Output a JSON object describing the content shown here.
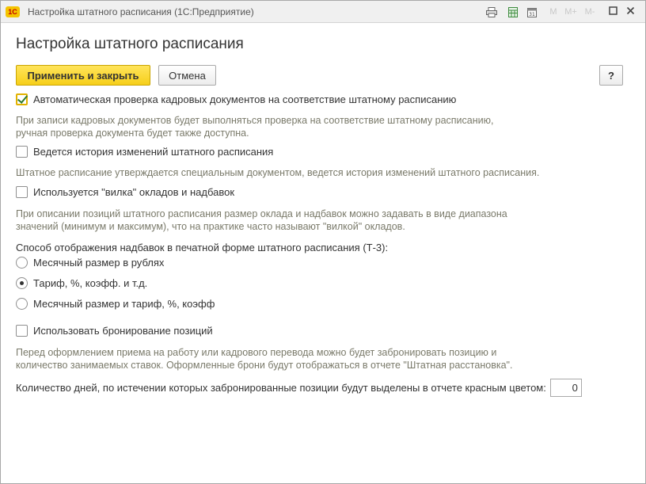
{
  "window": {
    "title": "Настройка штатного расписания  (1С:Предприятие)",
    "logo_text": "1С"
  },
  "header": {
    "title": "Настройка штатного расписания"
  },
  "toolbar": {
    "apply_close_label": "Применить и закрыть",
    "cancel_label": "Отмена",
    "help_label": "?"
  },
  "options": {
    "auto_check": {
      "label": "Автоматическая проверка кадровых документов на соответствие штатному расписанию",
      "checked": true,
      "hint_line1": "При записи кадровых документов будет выполняться проверка на соответствие штатному расписанию,",
      "hint_line2": "ручная проверка документа будет также доступна."
    },
    "history": {
      "label": "Ведется история изменений штатного расписания",
      "checked": false,
      "hint_line1": "Штатное расписание утверждается специальным документом, ведется история изменений штатного расписания."
    },
    "fork": {
      "label": "Используется \"вилка\" окладов и надбавок",
      "checked": false,
      "hint_line1": "При описании позиций штатного расписания размер оклада и надбавок можно задавать в виде диапазона",
      "hint_line2": "значений (минимум и максимум), что на практике часто называют \"вилкой\" окладов."
    },
    "display_mode": {
      "label": "Способ отображения надбавок в печатной форме штатного расписания (Т-3):",
      "choices": [
        {
          "label": "Месячный размер в рублях",
          "selected": false
        },
        {
          "label": "Тариф, %, коэфф. и т.д.",
          "selected": true
        },
        {
          "label": "Месячный размер и тариф, %, коэфф",
          "selected": false
        }
      ]
    },
    "booking": {
      "label": "Использовать бронирование позиций",
      "checked": false,
      "hint_line1": "Перед оформлением приема на работу или кадрового перевода можно будет забронировать позицию и",
      "hint_line2": "количество занимаемых ставок. Оформленные брони будут отображаться в отчете \"Штатная расстановка\"."
    },
    "days": {
      "label": "Количество дней, по истечении которых забронированные позиции будут выделены в отчете красным цветом:",
      "value": "0"
    }
  },
  "colors": {
    "primary_button": "#f6cf1a",
    "hint_text": "#7a7a6a",
    "check_mark": "#2c7a2c"
  }
}
